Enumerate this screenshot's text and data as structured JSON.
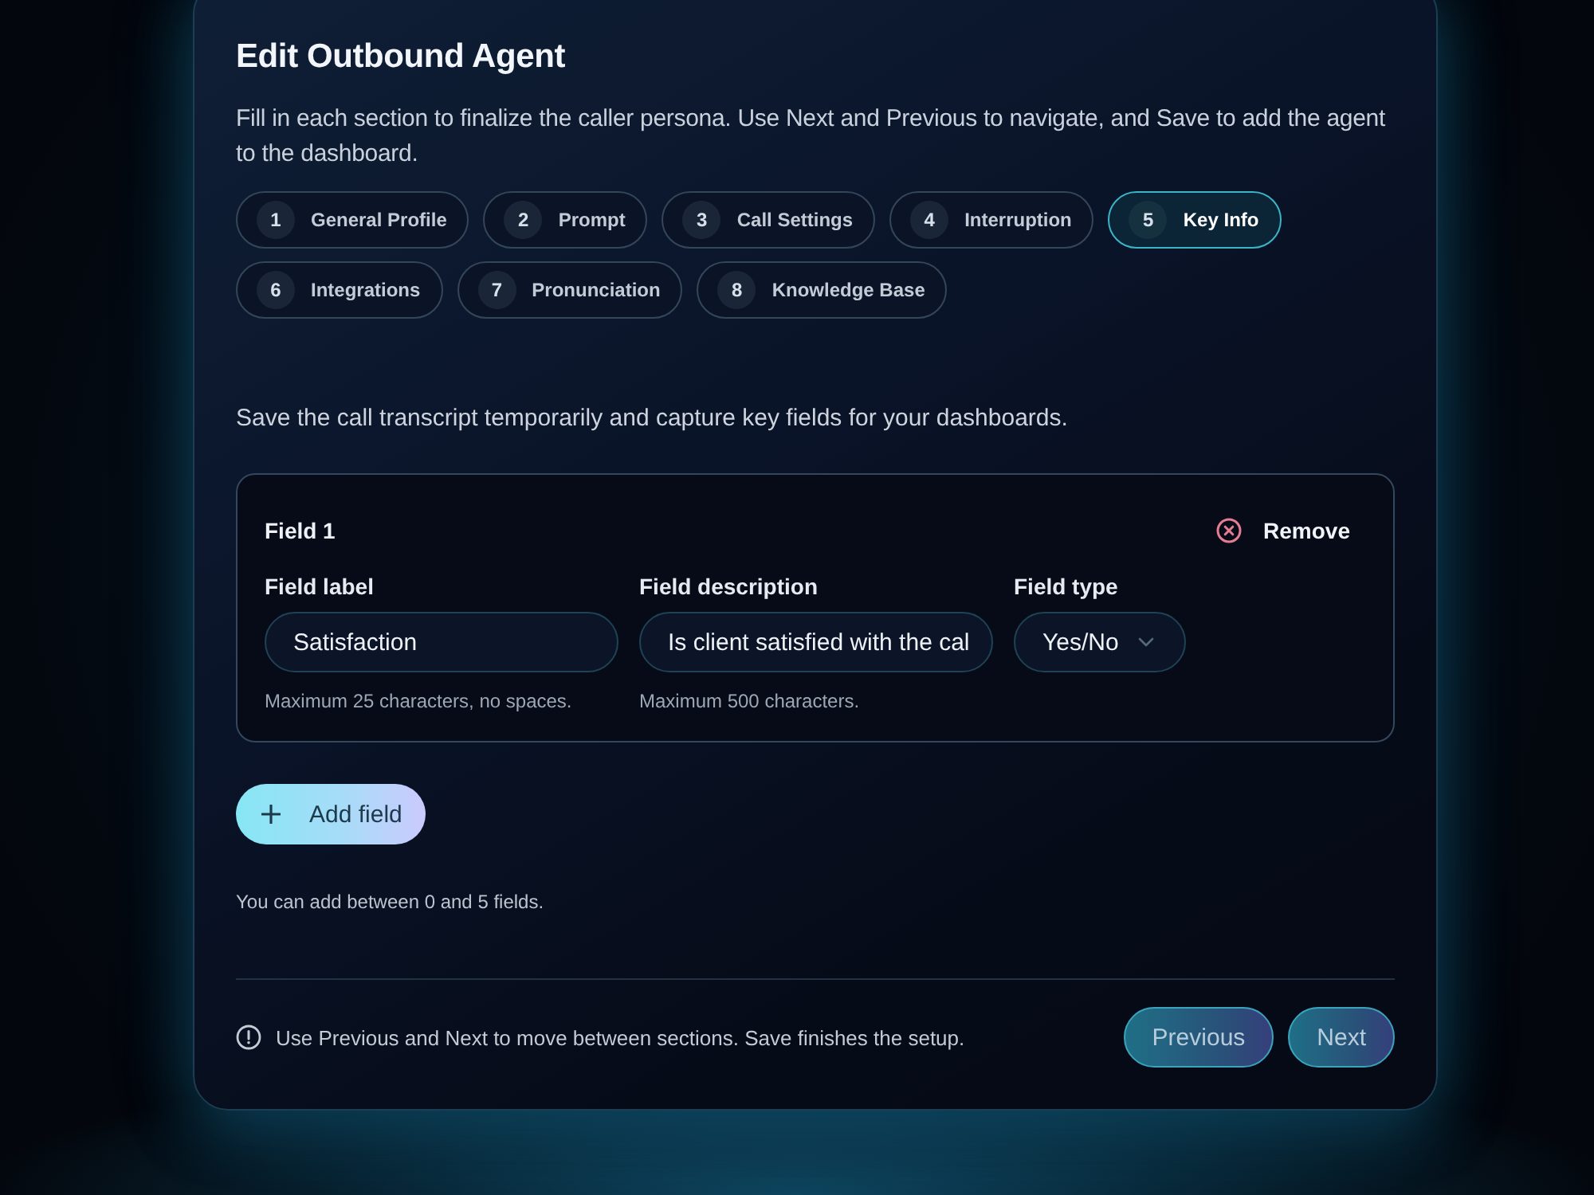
{
  "dialog": {
    "title": "Edit Outbound Agent",
    "description": "Fill in each section to finalize the caller persona. Use Next and Previous to navigate, and Save to add the agent to the dashboard."
  },
  "steps": [
    {
      "number": "1",
      "label": "General Profile",
      "selected": false
    },
    {
      "number": "2",
      "label": "Prompt",
      "selected": false
    },
    {
      "number": "3",
      "label": "Call Settings",
      "selected": false
    },
    {
      "number": "4",
      "label": "Interruption",
      "selected": false
    },
    {
      "number": "5",
      "label": "Key Info",
      "selected": true
    },
    {
      "number": "6",
      "label": "Integrations",
      "selected": false
    },
    {
      "number": "7",
      "label": "Pronunciation",
      "selected": false
    },
    {
      "number": "8",
      "label": "Knowledge Base",
      "selected": false
    }
  ],
  "section": {
    "intro": "Save the call transcript temporarily and capture key fields for your dashboards.",
    "fields": [
      {
        "heading": "Field 1",
        "remove_label": "Remove",
        "label": {
          "caption": "Field label",
          "value": "Satisfaction",
          "hint": "Maximum 25 characters, no spaces."
        },
        "description": {
          "caption": "Field description",
          "value": "Is client satisfied with the cal",
          "hint": "Maximum 500 characters."
        },
        "type": {
          "caption": "Field type",
          "value": "Yes/No"
        }
      }
    ],
    "add_button": "Add field",
    "limit_note": "You can add between 0 and 5 fields."
  },
  "footer": {
    "note": "Use Previous and Next to move between sections. Save finishes the setup.",
    "buttons": [
      "Previous",
      "Next"
    ]
  }
}
